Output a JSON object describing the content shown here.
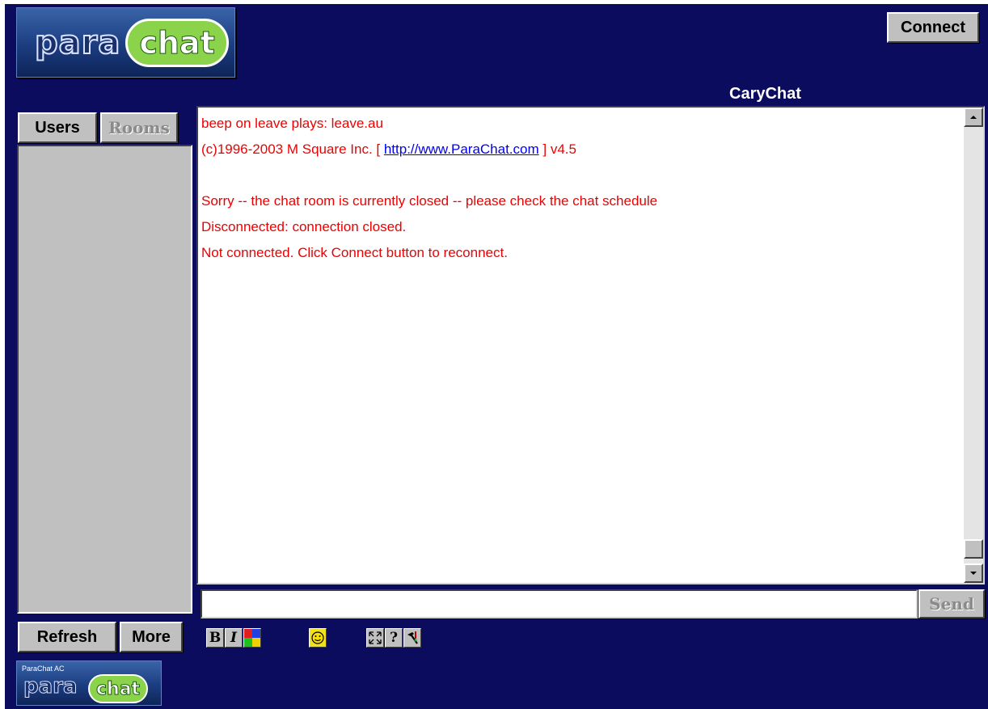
{
  "logo": {
    "para": "para",
    "chat": "chat"
  },
  "header": {
    "connect_label": "Connect",
    "room_title": "CaryChat"
  },
  "sidebar": {
    "tabs": [
      {
        "label": "Users",
        "enabled": true
      },
      {
        "label": "Rooms",
        "enabled": false
      }
    ],
    "refresh_label": "Refresh",
    "more_label": "More"
  },
  "messages": [
    {
      "text": "beep on leave plays: leave.au"
    },
    {
      "prefix": " (c)1996-2003 M Square Inc. [ ",
      "link": "http://www.ParaChat.com",
      "suffix": " ] v4.5"
    },
    {
      "text": ""
    },
    {
      "text": "Sorry -- the chat room is currently closed -- please check the chat schedule"
    },
    {
      "text": "Disconnected: connection closed."
    },
    {
      "text": "Not connected. Click Connect button to reconnect."
    }
  ],
  "input": {
    "value": "",
    "send_label": "Send"
  },
  "toolbar": {
    "bold": "B",
    "italic": "I",
    "help": "?"
  },
  "footer_logo": {
    "caption": "ParaChat AC",
    "para": "para",
    "chat": "chat"
  },
  "colors": {
    "background": "#0c0c5e",
    "message_text": "#ee0000",
    "link": "#0000ee",
    "face": "#c0c0c0"
  }
}
